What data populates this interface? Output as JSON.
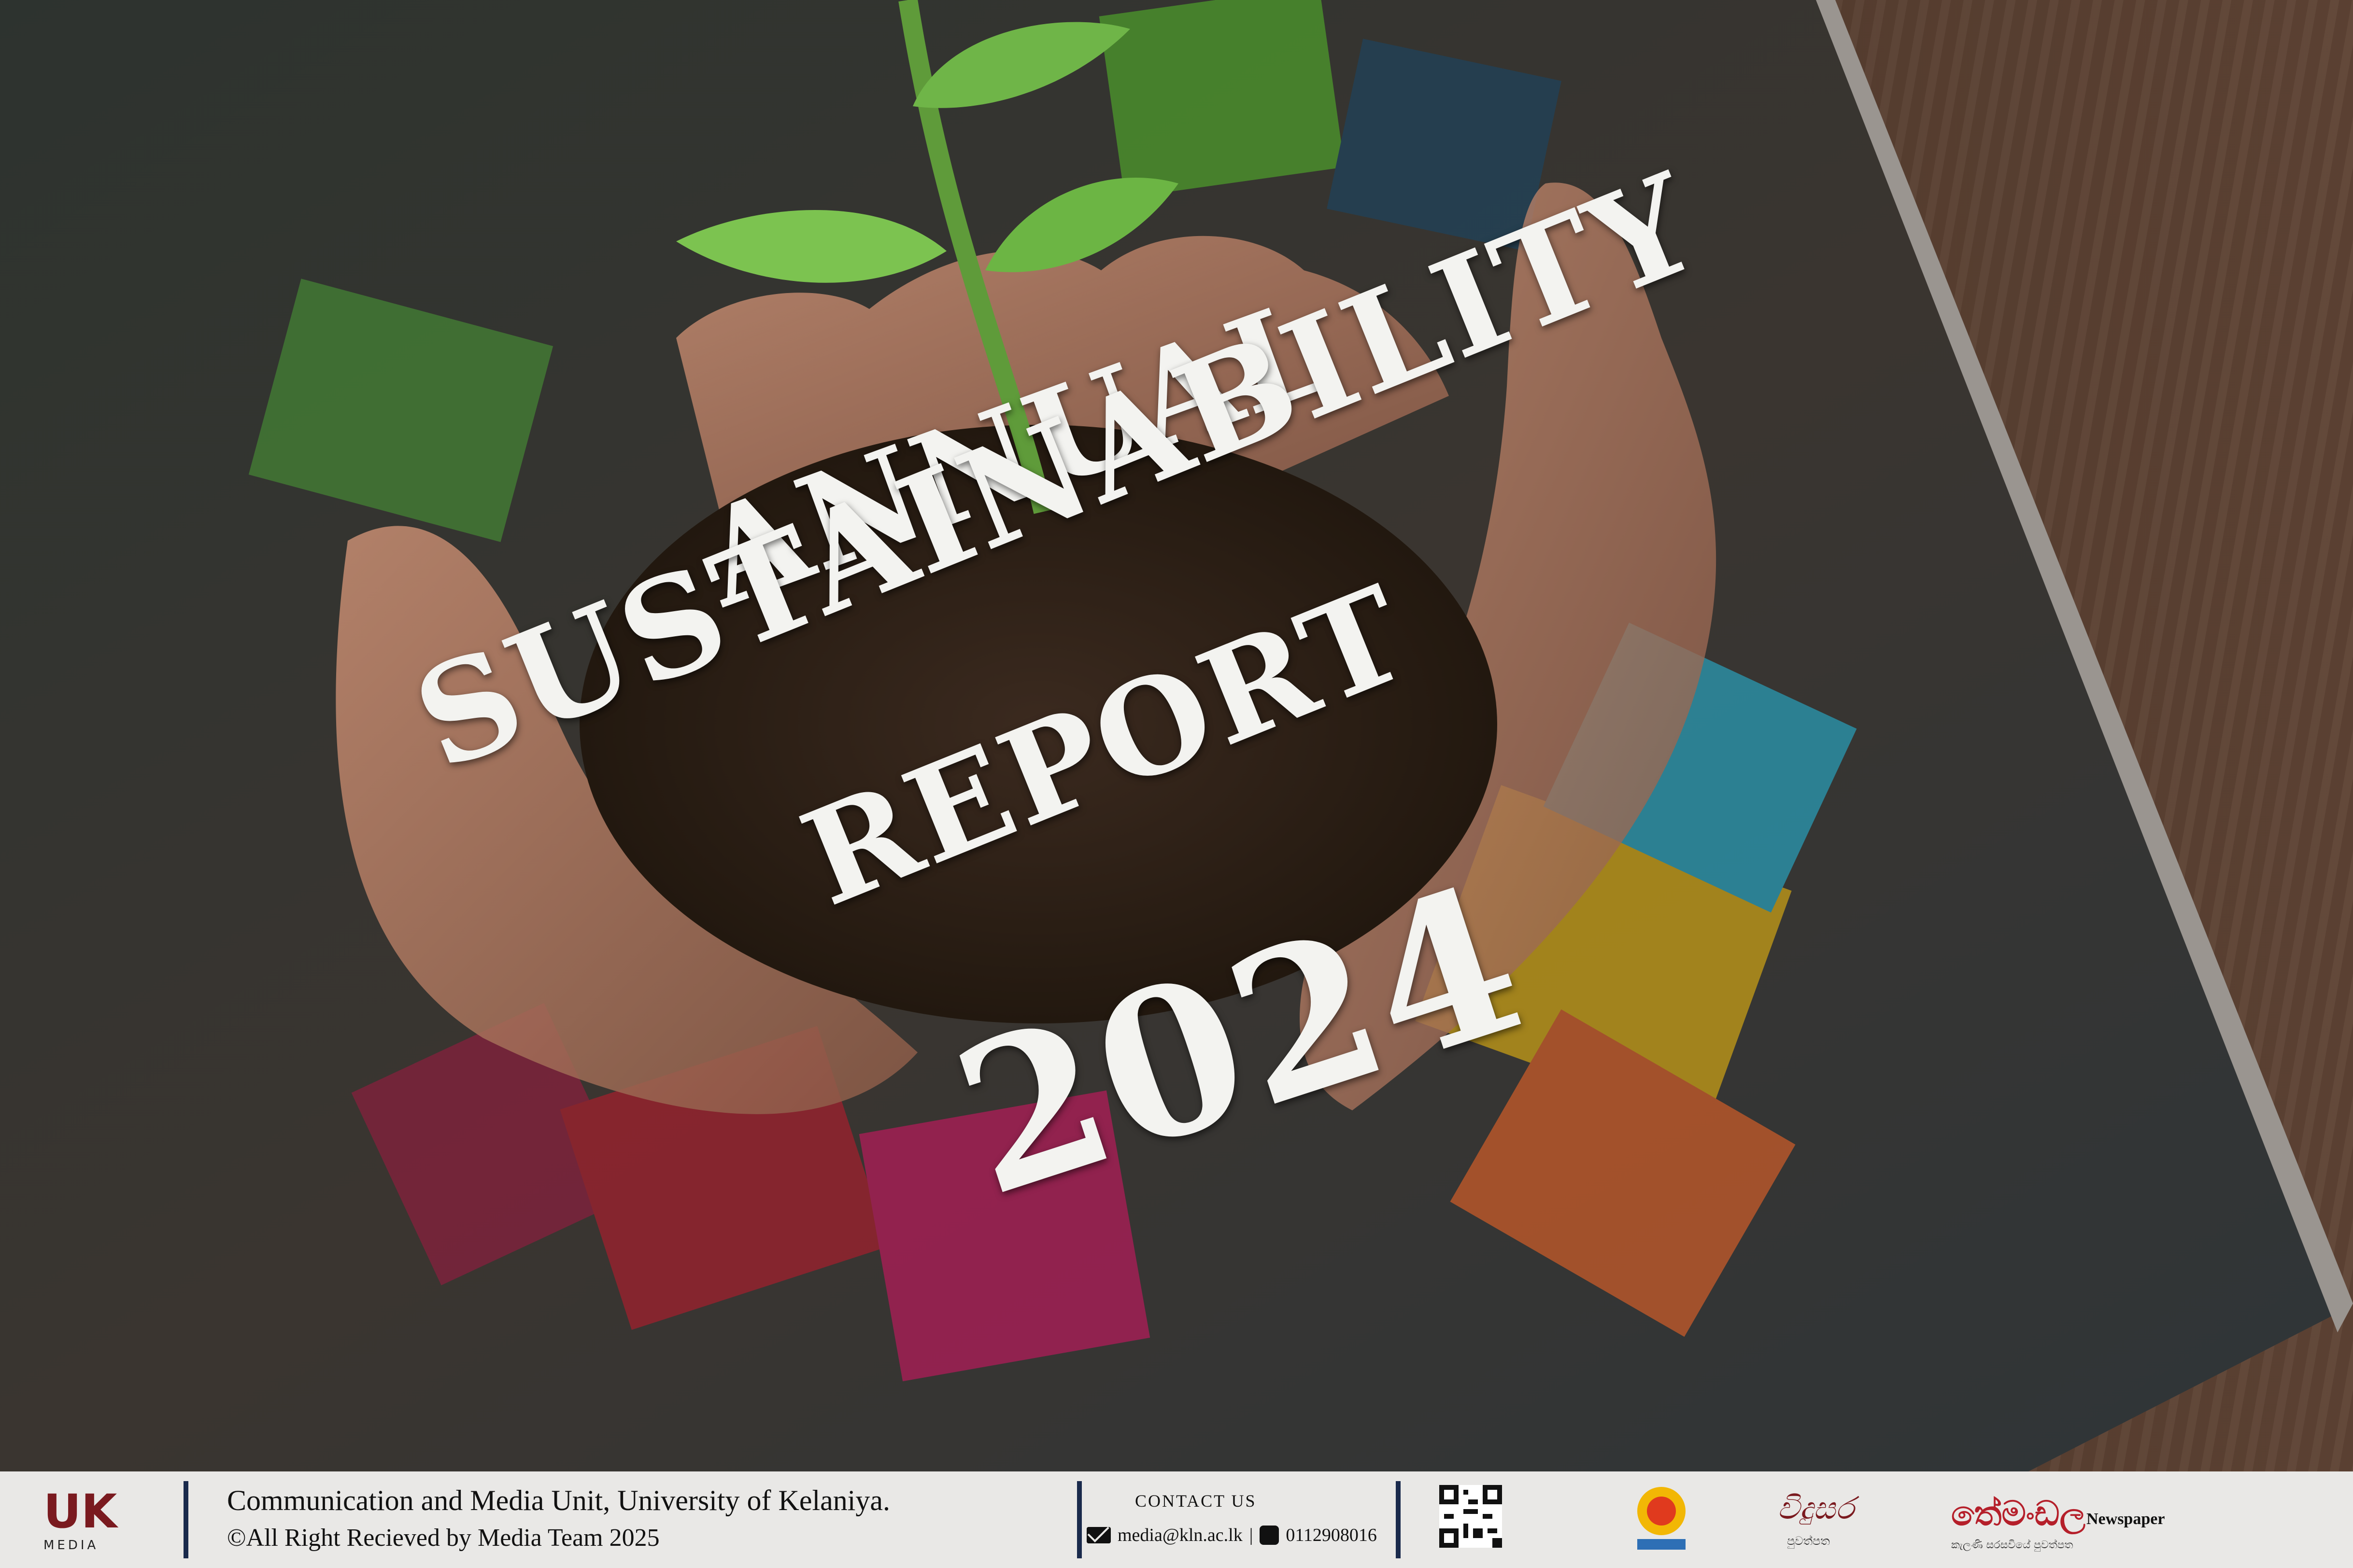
{
  "cover": {
    "line1": "ANNUAL",
    "line2": "SUSTAINABILITY",
    "line3": "REPORT",
    "year": "2024"
  },
  "footer": {
    "logo_text": "UK",
    "logo_sub": "MEDIA",
    "org_line1": "Communication and Media Unit, University of Kelaniya.",
    "org_line2": "©All Right Recieved by Media Team 2025",
    "contact_heading": "CONTACT US",
    "email": "media@kln.ac.lk",
    "phone": "0112908016",
    "vidu_logo": "විදුසර",
    "vidu_sub": "පුවත්පත",
    "newspaper_logo": "තේමංඩල",
    "newspaper_sub": "කැලණි සරසවියේ පුවත්පත",
    "newspaper_word": "Newspaper"
  },
  "colors": {
    "footer_bg": "#e9e8e6",
    "separator": "#1a2a4c",
    "title_text": "#f3f3f0",
    "brand_red": "#7a1a1f"
  }
}
